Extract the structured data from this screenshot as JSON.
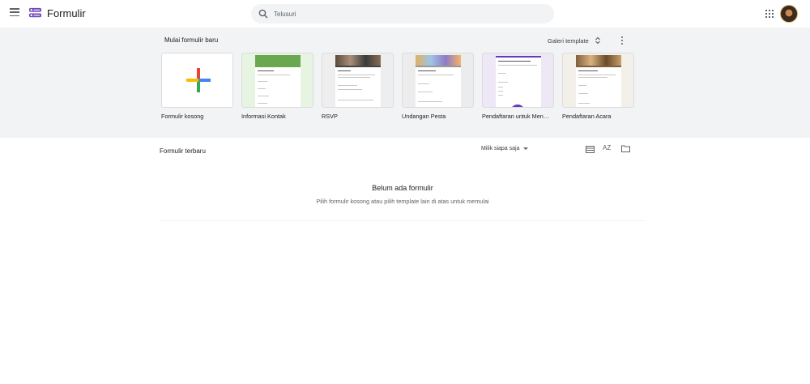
{
  "app": {
    "title": "Formulir"
  },
  "search": {
    "placeholder": "Telusuri"
  },
  "templates_section": {
    "title": "Mulai formulir baru",
    "gallery_label": "Galeri template",
    "items": [
      {
        "label": "Formulir kosong",
        "accent": "#ffffff"
      },
      {
        "label": "Informasi Kontak",
        "accent": "#6aa84f"
      },
      {
        "label": "RSVP",
        "accent": "#5c4a3a"
      },
      {
        "label": "Undangan Pesta",
        "accent": "#8e7cc3"
      },
      {
        "label": "Pendaftaran untuk Men…",
        "accent": "#673ab7"
      },
      {
        "label": "Pendaftaran Acara",
        "accent": "#7f5f3f"
      }
    ]
  },
  "recent": {
    "title": "Formulir terbaru",
    "owner_filter": "Milik siapa saja",
    "sort_label": "AZ",
    "empty_title": "Belum ada formulir",
    "empty_subtitle": "Pilih formulir kosong atau pilih template lain di atas untuk memulai"
  },
  "colors": {
    "band_bg": "#f1f3f4",
    "plus_blue": "#4285f4",
    "plus_red": "#ea4335",
    "plus_yellow": "#fbbc04",
    "plus_green": "#34a853"
  }
}
